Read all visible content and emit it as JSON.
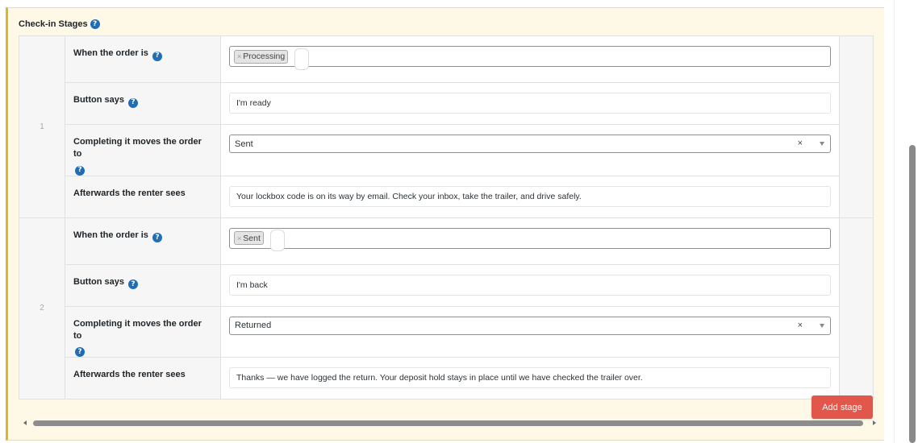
{
  "panel": {
    "title": "Check-in Stages",
    "help_glyph": "?"
  },
  "stages": [
    {
      "number": "1",
      "when_label": "When the order is",
      "when_chip": "Processing",
      "chip_remove": "×",
      "button_label": "Button says",
      "button_value": "I'm ready",
      "moves_label": "Completing it moves the order to",
      "moves_value": "Sent",
      "moves_clear": "×",
      "after_label": "Afterwards the renter sees",
      "after_value": "Your lockbox code is on its way by email. Check your inbox, take the trailer, and drive safely."
    },
    {
      "number": "2",
      "when_label": "When the order is",
      "when_chip": "Sent",
      "chip_remove": "×",
      "button_label": "Button says",
      "button_value": "I'm back",
      "moves_label": "Completing it moves the order to",
      "moves_value": "Returned",
      "moves_clear": "×",
      "after_label": "Afterwards the renter sees",
      "after_value": "Thanks — we have logged the return. Your deposit hold stays in place until we have checked the trailer over."
    }
  ],
  "actions": {
    "add_stage": "Add stage"
  },
  "icons": {
    "help": "question-circle-icon",
    "dropdown": "chevron-down-icon",
    "scroll_left": "arrow-left-icon",
    "scroll_right": "arrow-right-icon"
  },
  "colors": {
    "panel_bg": "#fef8e7",
    "panel_accent": "#dcb62a",
    "help_icon": "#1e6db6",
    "add_button": "#e2574c"
  }
}
